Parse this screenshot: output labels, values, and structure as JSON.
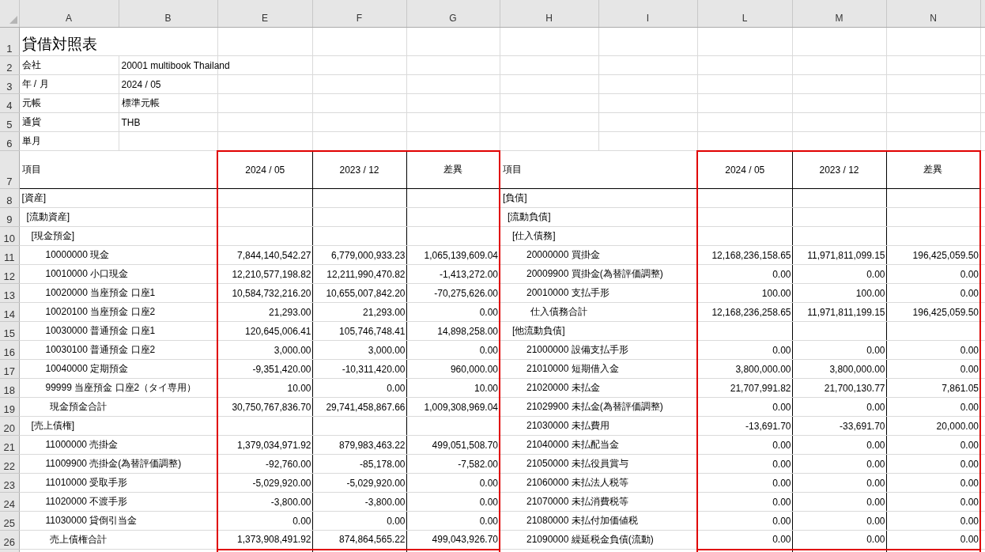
{
  "column_headers": [
    "A",
    "B",
    "E",
    "F",
    "G",
    "H",
    "I",
    "L",
    "M",
    "N"
  ],
  "row_numbers": [
    "1",
    "2",
    "3",
    "4",
    "5",
    "6",
    "7",
    "8",
    "9",
    "10",
    "11",
    "12",
    "13",
    "14",
    "15",
    "16",
    "17",
    "18",
    "19",
    "20",
    "21",
    "22",
    "23",
    "24",
    "25",
    "26"
  ],
  "title": "貸借対照表",
  "meta": [
    {
      "label": "会社",
      "value": "20001 multibook Thailand"
    },
    {
      "label": "年 / 月",
      "value": "2024 / 05"
    },
    {
      "label": "元帳",
      "value": "標準元帳"
    },
    {
      "label": "通貨",
      "value": "THB"
    },
    {
      "label": "単月"
    }
  ],
  "left_columns": [
    "項目",
    "2024 / 05",
    "2023 / 12",
    "差異"
  ],
  "right_columns": [
    "項目",
    "2024 / 05",
    "2023 / 12",
    "差異"
  ],
  "left_rows": [
    {
      "kind": "section",
      "label": "[資産]"
    },
    {
      "kind": "category",
      "label": "[流動資産]"
    },
    {
      "kind": "group",
      "label": "[現金預金]"
    },
    {
      "kind": "account",
      "label": "10000000 現金",
      "values": [
        "7,844,140,542.27",
        "6,779,000,933.23",
        "1,065,139,609.04"
      ]
    },
    {
      "kind": "account",
      "label": "10010000 小口現金",
      "values": [
        "12,210,577,198.82",
        "12,211,990,470.82",
        "-1,413,272.00"
      ]
    },
    {
      "kind": "account",
      "label": "10020000 当座預金 口座1",
      "values": [
        "10,584,732,216.20",
        "10,655,007,842.20",
        "-70,275,626.00"
      ]
    },
    {
      "kind": "account",
      "label": "10020100 当座預金 口座2",
      "values": [
        "21,293.00",
        "21,293.00",
        "0.00"
      ]
    },
    {
      "kind": "account",
      "label": "10030000 普通預金 口座1",
      "values": [
        "120,645,006.41",
        "105,746,748.41",
        "14,898,258.00"
      ]
    },
    {
      "kind": "account",
      "label": "10030100 普通預金 口座2",
      "values": [
        "3,000.00",
        "3,000.00",
        "0.00"
      ]
    },
    {
      "kind": "account",
      "label": "10040000 定期預金",
      "values": [
        "-9,351,420.00",
        "-10,311,420.00",
        "960,000.00"
      ]
    },
    {
      "kind": "account",
      "label": "99999 当座預金 口座2（タイ専用）",
      "values": [
        "10.00",
        "0.00",
        "10.00"
      ]
    },
    {
      "kind": "total",
      "label": "現金預金合計",
      "values": [
        "30,750,767,836.70",
        "29,741,458,867.66",
        "1,009,308,969.04"
      ]
    },
    {
      "kind": "group",
      "label": "[売上債権]"
    },
    {
      "kind": "account",
      "label": "11000000 売掛金",
      "values": [
        "1,379,034,971.92",
        "879,983,463.22",
        "499,051,508.70"
      ]
    },
    {
      "kind": "account",
      "label": "11009900 売掛金(為替評価調整)",
      "values": [
        "-92,760.00",
        "-85,178.00",
        "-7,582.00"
      ]
    },
    {
      "kind": "account",
      "label": "11010000 受取手形",
      "values": [
        "-5,029,920.00",
        "-5,029,920.00",
        "0.00"
      ]
    },
    {
      "kind": "account",
      "label": "11020000 不渡手形",
      "values": [
        "-3,800.00",
        "-3,800.00",
        "0.00"
      ]
    },
    {
      "kind": "account",
      "label": "11030000 貸倒引当金",
      "values": [
        "0.00",
        "0.00",
        "0.00"
      ]
    },
    {
      "kind": "total",
      "label": "売上債権合計",
      "values": [
        "1,373,908,491.92",
        "874,864,565.22",
        "499,043,926.70"
      ]
    }
  ],
  "right_rows": [
    {
      "kind": "section",
      "label": "[負債]"
    },
    {
      "kind": "category",
      "label": "[流動負債]"
    },
    {
      "kind": "group",
      "label": "[仕入債務]"
    },
    {
      "kind": "account",
      "label": "20000000 買掛金",
      "values": [
        "12,168,236,158.65",
        "11,971,811,099.15",
        "196,425,059.50"
      ]
    },
    {
      "kind": "account",
      "label": "20009900 買掛金(為替評価調整)",
      "values": [
        "0.00",
        "0.00",
        "0.00"
      ]
    },
    {
      "kind": "account",
      "label": "20010000 支払手形",
      "values": [
        "100.00",
        "100.00",
        "0.00"
      ]
    },
    {
      "kind": "total",
      "label": "仕入債務合計",
      "values": [
        "12,168,236,258.65",
        "11,971,811,199.15",
        "196,425,059.50"
      ]
    },
    {
      "kind": "group",
      "label": "[他流動負債]"
    },
    {
      "kind": "account",
      "label": "21000000 設備支払手形",
      "values": [
        "0.00",
        "0.00",
        "0.00"
      ]
    },
    {
      "kind": "account",
      "label": "21010000 短期借入金",
      "values": [
        "3,800,000.00",
        "3,800,000.00",
        "0.00"
      ]
    },
    {
      "kind": "account",
      "label": "21020000 未払金",
      "values": [
        "21,707,991.82",
        "21,700,130.77",
        "7,861.05"
      ]
    },
    {
      "kind": "account",
      "label": "21029900 未払金(為替評価調整)",
      "values": [
        "0.00",
        "0.00",
        "0.00"
      ]
    },
    {
      "kind": "account",
      "label": "21030000 未払費用",
      "values": [
        "-13,691.70",
        "-33,691.70",
        "20,000.00"
      ]
    },
    {
      "kind": "account",
      "label": "21040000 未払配当金",
      "values": [
        "0.00",
        "0.00",
        "0.00"
      ]
    },
    {
      "kind": "account",
      "label": "21050000 未払役員賞与",
      "values": [
        "0.00",
        "0.00",
        "0.00"
      ]
    },
    {
      "kind": "account",
      "label": "21060000 未払法人税等",
      "values": [
        "0.00",
        "0.00",
        "0.00"
      ]
    },
    {
      "kind": "account",
      "label": "21070000 未払消費税等",
      "values": [
        "0.00",
        "0.00",
        "0.00"
      ]
    },
    {
      "kind": "account",
      "label": "21080000 未払付加価値税",
      "values": [
        "0.00",
        "0.00",
        "0.00"
      ]
    },
    {
      "kind": "account",
      "label": "21090000 繰延税金負債(流動)",
      "values": [
        "0.00",
        "0.00",
        "0.00"
      ]
    }
  ]
}
